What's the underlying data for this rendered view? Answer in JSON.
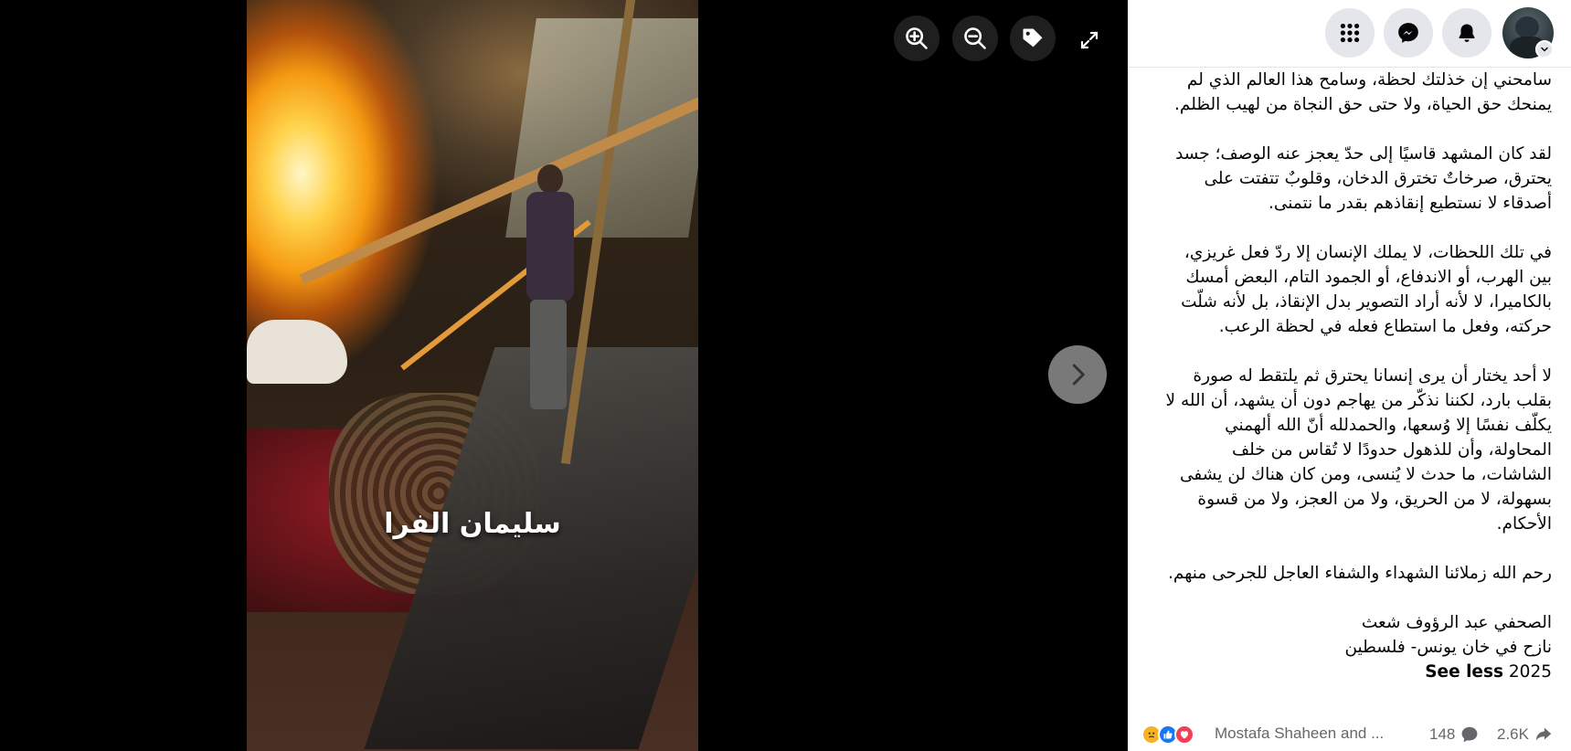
{
  "viewer": {
    "caption": "سليمان الفرا",
    "tools": [
      {
        "name": "zoom-in",
        "icon": "zoom-in-icon"
      },
      {
        "name": "zoom-out",
        "icon": "zoom-out-icon"
      },
      {
        "name": "tag",
        "icon": "tag-icon"
      },
      {
        "name": "fullscreen",
        "icon": "expand-icon"
      }
    ],
    "next_icon": "chevron-right-icon"
  },
  "topbar": {
    "icons": [
      "menu-grid-icon",
      "messenger-icon",
      "notifications-bell-icon",
      "account-avatar"
    ]
  },
  "post": {
    "paragraphs": [
      [
        "سامحني إن خذلتك لحظة، وسامح هذا العالم الذي لم",
        "يمنحك حق الحياة، ولا حتى حق النجاة من لهيب الظلم."
      ],
      [
        "لقد كان المشهد قاسيًا إلى حدّ يعجز عنه الوصف؛ جسد",
        "يحترق، صرخاتٌ تخترق الدخان، وقلوبٌ تتفتت على",
        "أصدقاء لا نستطيع إنقاذهم بقدر ما نتمنى."
      ],
      [
        "في تلك اللحظات، لا يملك الإنسان إلا ردّ فعل غريزي،",
        "بين الهرب، أو الاندفاع، أو الجمود التام، البعض أمسك",
        "بالكاميرا، لا لأنه أراد التصوير بدل الإنقاذ، بل لأنه شلّت",
        "حركته، وفعل ما استطاع فعله في لحظة الرعب."
      ],
      [
        "لا أحد يختار أن يرى إنسانا يحترق ثم يلتقط له صورة",
        "بقلب بارد، لكننا نذكّر من يهاجم دون أن يشهد، أن الله لا",
        "يكلّف نفسًا إلا وُسعها، والحمدلله أنّ الله ألهمني",
        "المحاولة، وأن للذهول حدودًا لا تُقاس من خلف",
        "الشاشات، ما حدث لا يُنسى، ومن كان هناك لن يشفى",
        "بسهولة، لا من الحريق، ولا من العجز، ولا من قسوة",
        "الأحكام."
      ],
      [
        "رحم الله زملائنا الشهداء والشفاء العاجل للجرحى منهم."
      ]
    ],
    "signature": [
      "الصحفي عبد الرؤوف شعث",
      "نازح في خان يونس- فلسطين"
    ],
    "year": "2025",
    "see_less": "See less"
  },
  "footer": {
    "reactions": [
      "sad",
      "like",
      "love"
    ],
    "reaction_names": "Mostafa Shaheen and ...",
    "comments": "148",
    "shares": "2.6K"
  },
  "colors": {
    "panel_bg": "#ffffff",
    "viewer_bg": "#000000",
    "button_gray": "#e4e6eb",
    "text": "#050505",
    "meta_text": "#65676b",
    "like_blue": "#1877f2",
    "love_red": "#f33e58",
    "sad_yellow": "#f7b125"
  }
}
